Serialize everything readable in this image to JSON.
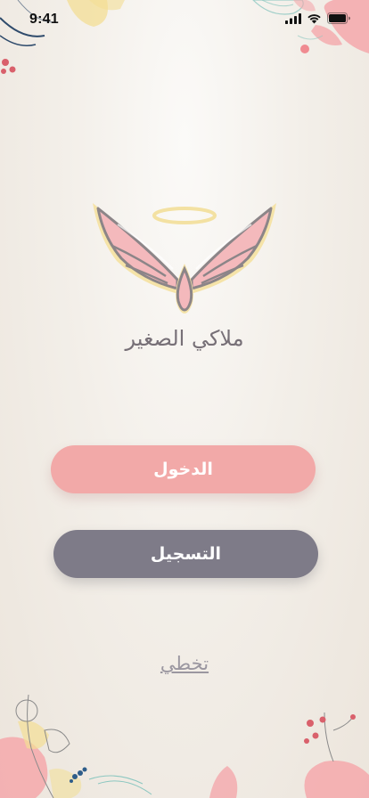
{
  "status_bar": {
    "time": "9:41"
  },
  "brand": {
    "name": "ملاكي الصغير"
  },
  "buttons": {
    "login": "الدخول",
    "register": "التسجيل"
  },
  "skip": {
    "label": "تخطي"
  },
  "colors": {
    "login_button": "#f2a9a8",
    "register_button": "#7e7b88",
    "halo": "#f3e1a2",
    "wing_pink": "#f4b9bc",
    "wing_outline": "#8c8588",
    "skip_text": "#9b97a0"
  },
  "icons": [
    "signal-icon",
    "wifi-icon",
    "battery-icon",
    "angel-wings-logo"
  ]
}
